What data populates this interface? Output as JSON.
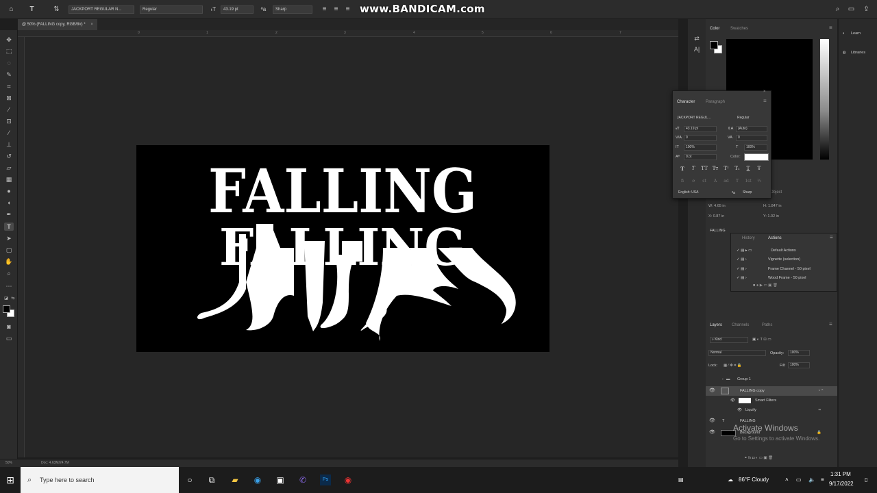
{
  "options_bar": {
    "font_family": "JACKPORT REGULAR N...",
    "font_style": "Regular",
    "font_size": "43.19 pt",
    "antialias": "Sharp"
  },
  "watermark": "www.BANDICAM.com",
  "document_tab": {
    "title": "@ 50% (FALLING copy, RGB/8#) *",
    "close": "×"
  },
  "rulers": {
    "top_ticks": [
      "0",
      "1",
      "2",
      "3",
      "4",
      "5",
      "6",
      "7"
    ]
  },
  "canvas": {
    "art_text": "FALLING",
    "text_color": "#ffffff",
    "background": "#000000"
  },
  "status_bar": {
    "zoom": "50%",
    "doc_size": "Doc: 4.63M/24.7M"
  },
  "color_panel": {
    "tabs": [
      "Color",
      "Swatches"
    ],
    "fg_color": "#000000",
    "bg_color": "#ffffff"
  },
  "learn_panel": {
    "items": [
      "Learn",
      "Libraries"
    ]
  },
  "character_panel": {
    "tabs": [
      "Character",
      "Paragraph"
    ],
    "font_family": "JACKPORT REGUL...",
    "font_style": "Regular",
    "size": "43.19 pt",
    "leading": "(Auto)",
    "kerning": "0",
    "tracking": "0",
    "vertical_scale": "100%",
    "horizontal_scale": "100%",
    "baseline_shift": "0 pt",
    "color_label": "Color:",
    "color_swatch": "#ffffff",
    "language": "English: USA",
    "antialias": "Sharp",
    "type_buttons": [
      "T",
      "T",
      "TT",
      "Tт",
      "T¹",
      "T₁",
      "T",
      "Ŧ"
    ],
    "opentype_buttons": [
      "fi",
      "ơ",
      "st",
      "A",
      "ad",
      "T",
      "1st",
      "½"
    ]
  },
  "properties_panel": {
    "object_label": "Object",
    "w": "W: 4.65 in",
    "h": "H: 1.847 in",
    "x": "X: 0.87 in",
    "y": "Y: 1.02 in",
    "layer_name": "FALLING"
  },
  "history_panel": {
    "tabs": [
      "History",
      "Actions"
    ],
    "items": [
      "Default Actions",
      "Vignette (selection)",
      "Frame Channel - 50 pixel",
      "Wood Frame - 50 pixel"
    ]
  },
  "layers_panel": {
    "tabs": [
      "Layers",
      "Channels",
      "Paths"
    ],
    "kind_label": "Kind",
    "blend_mode": "Normal",
    "opacity_label": "Opacity:",
    "opacity": "100%",
    "lock_label": "Lock:",
    "fill_label": "Fill:",
    "fill": "100%",
    "layers": [
      "Group 1",
      "FALLING copy",
      "Smart Filters",
      "Liquify",
      "FALLING",
      "Background"
    ]
  },
  "activate_windows": {
    "title": "Activate Windows",
    "subtitle": "Go to Settings to activate Windows."
  },
  "taskbar": {
    "search_placeholder": "Type here to search",
    "weather": "86°F  Cloudy",
    "time": "1:31 PM",
    "date": "9/17/2022"
  }
}
